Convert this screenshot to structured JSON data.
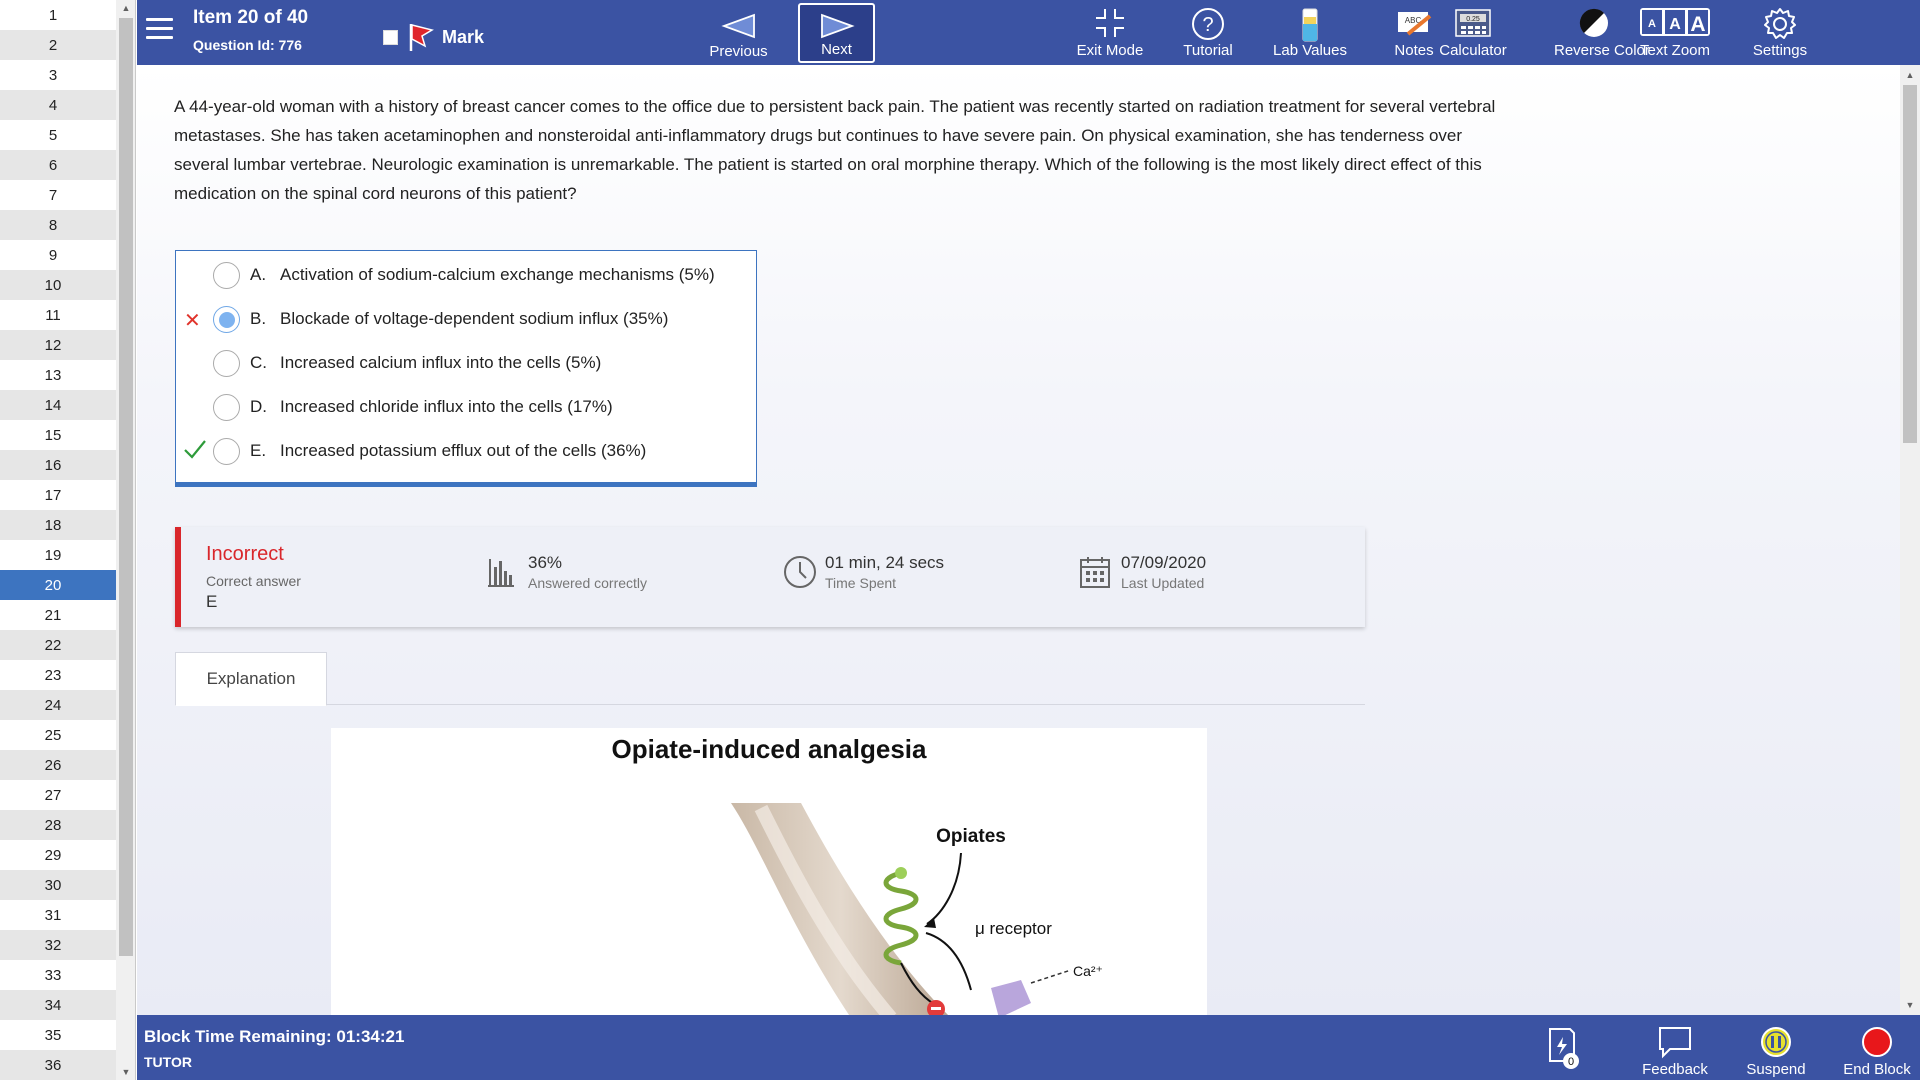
{
  "sidebar": {
    "numbers": [
      "1",
      "2",
      "3",
      "4",
      "5",
      "6",
      "7",
      "8",
      "9",
      "10",
      "11",
      "12",
      "13",
      "14",
      "15",
      "16",
      "17",
      "18",
      "19",
      "20",
      "21",
      "22",
      "23",
      "24",
      "25",
      "26",
      "27",
      "28",
      "29",
      "30",
      "31",
      "32",
      "33",
      "34",
      "35",
      "36"
    ],
    "active": "20"
  },
  "header": {
    "item": "Item 20 of 40",
    "question_id": "Question Id: 776",
    "mark_label": "Mark",
    "previous_label": "Previous",
    "next_label": "Next",
    "tools": {
      "exit_mode": "Exit Mode",
      "tutorial": "Tutorial",
      "lab_values": "Lab Values",
      "notes": "Notes",
      "calculator": "Calculator",
      "reverse_color": "Reverse Color",
      "text_zoom": "Text Zoom",
      "settings": "Settings"
    },
    "notes_icon_text": "ABC",
    "calculator_icon_text": "0.25",
    "text_zoom_icon_letters": [
      "A",
      "A",
      "A"
    ]
  },
  "question": {
    "stem": "A 44-year-old woman with a history of breast cancer comes to the office due to persistent back pain.  The patient was recently started on radiation treatment for several vertebral metastases.  She has taken acetaminophen and nonsteroidal anti-inflammatory drugs but continues to have severe pain.  On physical examination, she has tenderness over several lumbar vertebrae.  Neurologic examination is unremarkable.  The patient is started on oral morphine therapy.  Which of the following is the most likely direct effect of this medication on the spinal cord neurons of this patient?",
    "answers": [
      {
        "letter": "A.",
        "text": "Activation of sodium-calcium exchange mechanisms (5%)"
      },
      {
        "letter": "B.",
        "text": "Blockade of voltage-dependent sodium influx (35%)"
      },
      {
        "letter": "C.",
        "text": "Increased calcium influx into the cells (5%)"
      },
      {
        "letter": "D.",
        "text": "Increased chloride influx into the cells (17%)"
      },
      {
        "letter": "E.",
        "text": "Increased potassium efflux out of the cells (36%)"
      }
    ],
    "selected": "B.",
    "correct": "E."
  },
  "result": {
    "status": "Incorrect",
    "correct_answer_label": "Correct answer",
    "correct_answer": "E",
    "percent": "36%",
    "percent_label": "Answered correctly",
    "time": "01 min, 24 secs",
    "time_label": "Time Spent",
    "date": "07/09/2020",
    "date_label": "Last Updated"
  },
  "explanation": {
    "tab_label": "Explanation",
    "figure_title": "Opiate-induced analgesia",
    "label_opiates": "Opiates",
    "label_receptor": "μ receptor",
    "label_ion": "Ca²⁺"
  },
  "footer": {
    "block_time": "Block Time Remaining: 01:34:21",
    "mode": "TUTOR",
    "flashcard_count": "0",
    "feedback": "Feedback",
    "suspend": "Suspend",
    "end_block": "End Block"
  },
  "colors": {
    "header_blue": "#3b53a3",
    "active_row": "#3d74c0",
    "incorrect_red": "#d9262b",
    "correct_green": "#2e9b3a"
  }
}
